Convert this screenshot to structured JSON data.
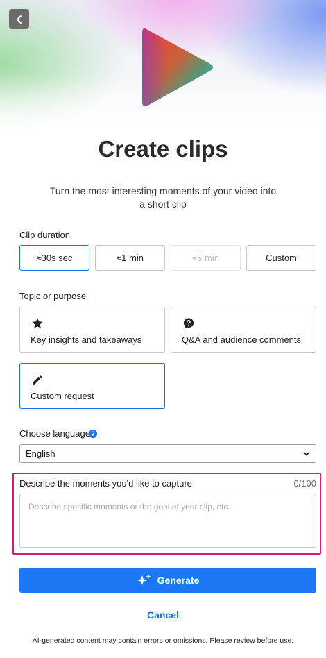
{
  "header": {
    "back_icon": "chevron-left-icon",
    "logo_icon": "play-triangle-icon",
    "title": "Create clips",
    "subtitle": "Turn the most interesting moments of your video into\na short clip"
  },
  "clip_duration": {
    "label": "Clip duration",
    "options": [
      {
        "label": "≈30s sec",
        "state": "selected"
      },
      {
        "label": "≈1 min",
        "state": "normal"
      },
      {
        "label": "≈5 min",
        "state": "disabled"
      },
      {
        "label": "Custom",
        "state": "normal"
      }
    ]
  },
  "topic": {
    "label": "Topic or purpose",
    "options": [
      {
        "label": "Key insights and takeaways",
        "icon": "star-icon",
        "state": "normal"
      },
      {
        "label": "Q&A and audience comments",
        "icon": "question-bubble-icon",
        "state": "normal"
      },
      {
        "label": "Custom request",
        "icon": "pencil-icon",
        "state": "selected"
      }
    ]
  },
  "language": {
    "label": "Choose language",
    "help_icon": "help-circle-icon",
    "help_glyph": "?",
    "selected": "English"
  },
  "describe": {
    "label": "Describe the moments you'd like to capture",
    "counter": "0/100",
    "placeholder": "Describe specific moments or the goal of your clip, etc.",
    "value": ""
  },
  "actions": {
    "generate_label": "Generate",
    "generate_icon": "sparkle-icon",
    "cancel_label": "Cancel"
  },
  "footer": {
    "disclaimer": "AI-generated content may contain errors or omissions. Please review before use."
  },
  "colors": {
    "accent": "#1b78f2",
    "selected_border": "#1872d6",
    "highlight": "#d81b74",
    "help_icon": "#1a73e8"
  }
}
